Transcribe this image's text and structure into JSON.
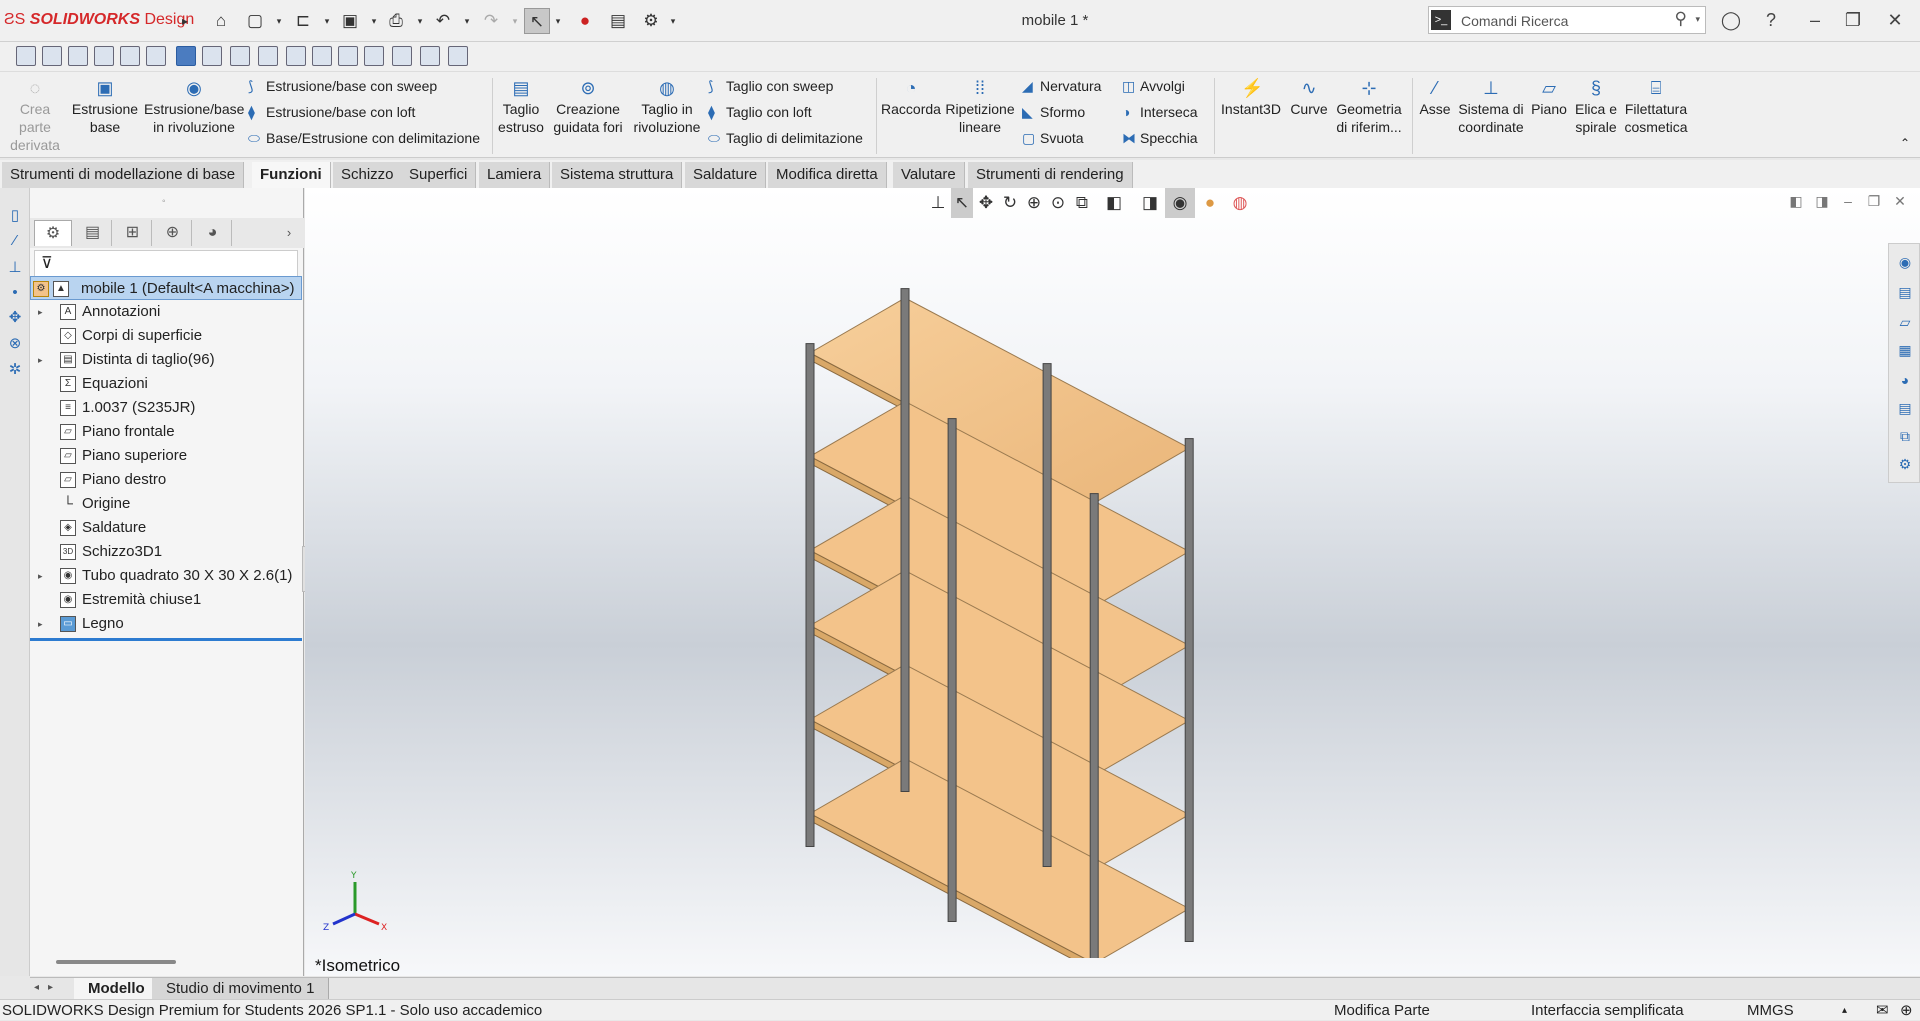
{
  "app": {
    "brand": "SOLIDWORKS",
    "brand_suffix": "Design",
    "document_title": "mobile 1 *"
  },
  "search": {
    "placeholder": "Comandi Ricerca"
  },
  "ribbon": {
    "items": [
      {
        "label": "Crea parte derivata"
      },
      {
        "label": "Estrusione base"
      },
      {
        "label": "Estrusione/base in rivoluzione"
      },
      {
        "label": "Estrusione/base con sweep"
      },
      {
        "label": "Estrusione/base con loft"
      },
      {
        "label": "Base/Estrusione con delimitazione"
      },
      {
        "label": "Taglio estruso"
      },
      {
        "label": "Creazione guidata fori"
      },
      {
        "label": "Taglio in rivoluzione"
      },
      {
        "label": "Taglio con sweep"
      },
      {
        "label": "Taglio con loft"
      },
      {
        "label": "Taglio di delimitazione"
      },
      {
        "label": "Raccorda"
      },
      {
        "label": "Ripetizione lineare"
      },
      {
        "label": "Nervatura"
      },
      {
        "label": "Sformo"
      },
      {
        "label": "Svuota"
      },
      {
        "label": "Avvolgi"
      },
      {
        "label": "Interseca"
      },
      {
        "label": "Specchia"
      },
      {
        "label": "Instant3D"
      },
      {
        "label": "Curve"
      },
      {
        "label": "Geometria di riferim..."
      },
      {
        "label": "Asse"
      },
      {
        "label": "Sistema di coordinate"
      },
      {
        "label": "Piano"
      },
      {
        "label": "Elica e spirale"
      },
      {
        "label": "Filettatura cosmetica"
      }
    ]
  },
  "tabs": [
    {
      "label": "Strumenti di modellazione di base"
    },
    {
      "label": "Funzioni"
    },
    {
      "label": "Schizzo"
    },
    {
      "label": "Superfici"
    },
    {
      "label": "Lamiera"
    },
    {
      "label": "Sistema struttura"
    },
    {
      "label": "Saldature"
    },
    {
      "label": "Modifica diretta"
    },
    {
      "label": "Valutare"
    },
    {
      "label": "Strumenti di rendering"
    }
  ],
  "tree": {
    "root": "mobile 1 (Default<A macchina>)",
    "items": [
      {
        "label": "Annotazioni",
        "icon": "A"
      },
      {
        "label": "Corpi di superficie",
        "icon": "◇"
      },
      {
        "label": "Distinta di taglio(96)",
        "icon": "▤"
      },
      {
        "label": "Equazioni",
        "icon": "Σ"
      },
      {
        "label": "1.0037 (S235JR)",
        "icon": "≡"
      },
      {
        "label": "Piano frontale",
        "icon": "▱"
      },
      {
        "label": "Piano superiore",
        "icon": "▱"
      },
      {
        "label": "Piano destro",
        "icon": "▱"
      },
      {
        "label": "Origine",
        "icon": "└"
      },
      {
        "label": "Saldature",
        "icon": "◈"
      },
      {
        "label": "Schizzo3D1",
        "icon": "3D"
      },
      {
        "label": "Tubo quadrato 30 X 30 X 2.6(1)",
        "icon": "◉"
      },
      {
        "label": "Estremità chiuse1",
        "icon": "◉"
      },
      {
        "label": "Legno",
        "icon": "▭"
      }
    ]
  },
  "viewport": {
    "view_label": "*Isometrico",
    "triad": {
      "y": "Y",
      "x": "X",
      "z": "Z"
    }
  },
  "bottom_tabs": [
    {
      "label": "Modello"
    },
    {
      "label": "Studio di movimento 1"
    }
  ],
  "status": {
    "left": "SOLIDWORKS Design Premium for Students 2026 SP1.1 - Solo uso accademico",
    "mode": "Modifica Parte",
    "ui": "Interfaccia semplificata",
    "units": "MMGS"
  },
  "colors": {
    "wood": "#f3c38a",
    "frame": "#6e6e6e",
    "accent": "#2c6cb4"
  }
}
